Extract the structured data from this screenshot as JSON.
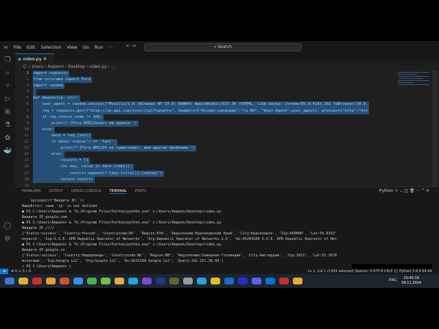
{
  "menu": [
    "File",
    "Edit",
    "Selection",
    "View",
    "Go",
    "Run",
    "···"
  ],
  "search": "Search",
  "tab": "video.py",
  "breadcrumb": "C: › Users › Кирилл › Desktop › video.py › ...",
  "code": [
    "import requests",
    "from colorama import Fore",
    "import random",
    "",
    "def deanon(ip: str):",
    "    user_agent = random.choice([\"Mozilla/5.0 (Windows NT 10.0; WOW64) AppleWebKit/537.36 (KHTML, like Gecko) Chrome/85.0.4183.102 YaBrowser/20.9.",
    "    req = requests.get(f\"http://ip-api.com/json/{ip}?lang=ru\", headers={\"Accept-Language\":\"ru-RU\", \"User-Agent\":user_agent}, proxies={\"http\":\"htt",
    "    if req.status_code != 200:",
    "        print(f'{Fore.RED}Запрос не удался.')",
    "    else:",
    "        data = req.json()",
    "        if data['status'] == 'fail':",
    "            print(f'{Fore.RED}IP не существует, или другая проблема.')",
    "        else:",
    "            results = []",
    "            for key, value in data.items():",
    "                results.append(f'{key.title()}:{value}')",
    "            return results",
    ""
  ],
  "panel_tabs": [
    "PROBLEMS",
    "OUTPUT",
    "DEBUG CONSOLE",
    "TERMINAL",
    "PORTS"
  ],
  "panel_actions": "Python  + ⌄  ◫  🗑  ···  ^  ✕",
  "terminal": [
    "    ip(input(f'Введите IP.'))",
    "NameError: name 'ip' is not defined",
    "● PS C:\\Users\\Кирилл> & \"D:/Program Files/Python/python.exe\" c:/Users/Кирилл/Desktop/video.py",
    "Введите IP.google.com",
    "● PS C:\\Users\\Кирилл> & \"D:/Program Files/Python/python.exe\" c:/Users/Кирилл/Desktop/video.py",
    "Введите IP.////",
    "['Status:success', 'Country:Россия', 'Countrycode:RU', 'Region:KYA', 'Regionname:Красноярский Край', 'City:Красноярск', 'Zip:660000', 'Lat:56.0153'",
    "noyarsk', 'Isp:S.U.E. DPR Republic Operator of Networks', 'Org:Republic Operator of Networks G.O', 'As:AS204108 S.U.E. DPR Republic Operator of Net",
    "● PS C:\\Users\\Кирилл> & \"D:/Program Files/Python/python.exe\" c:/Users/Кирилл/Desktop/video.py",
    "Введите IP.google.ru",
    "['Status:success', 'Country:Нидерланды', 'Countrycode:NL', 'Region:NH', 'Regionname:Северная Голландия', 'City:Амстердам', 'Zip:1012', 'Lat:52.3676",
    "msterdam', 'Isp:Google LLC', 'Org:Google LLC', 'As:AS15169 Google LLC', 'Query:142.251.39.99']",
    "○ PS C:\\Users\\Кирилл> ▯"
  ],
  "status": {
    "left": "⊗ 0 ⚠ 0   ⑂ 0",
    "right": "Ln 1, Col 1 (1304 selected)   Spaces: 4   UTF-8   CRLF   {} Python   3.8.9 64-bit"
  },
  "tray": "ENG",
  "clock": {
    "time": "20:45:18",
    "date": "09.11.2024"
  }
}
